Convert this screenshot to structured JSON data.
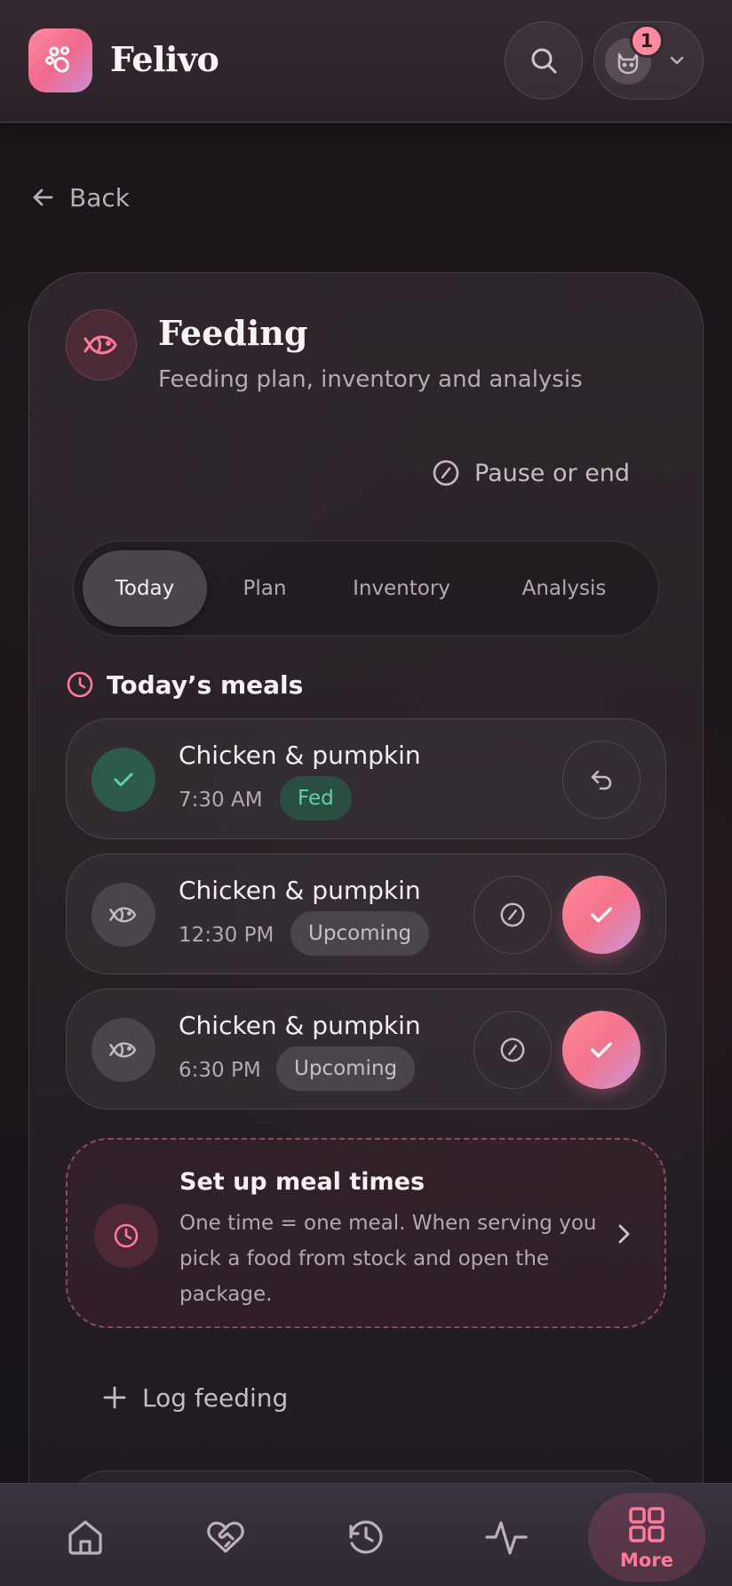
{
  "app": {
    "name": "Felivo",
    "notification_count": "1"
  },
  "icons": {
    "logo": "paw-icon",
    "search": "search-icon",
    "avatar": "cat-icon",
    "back": "arrow-left-icon",
    "feeding": "fish-icon",
    "pause": "slash-circle-icon",
    "clock": "clock-icon",
    "done": "check-icon",
    "undo": "undo-icon",
    "chevron": "chevron-right-icon",
    "plus": "plus-icon"
  },
  "nav": {
    "back_label": "Back"
  },
  "feeding": {
    "title": "Feeding",
    "subtitle": "Feeding plan, inventory and analysis",
    "pause_label": "Pause or end"
  },
  "tabs": [
    {
      "label": "Today",
      "active": true
    },
    {
      "label": "Plan",
      "active": false
    },
    {
      "label": "Inventory",
      "active": false
    },
    {
      "label": "Analysis",
      "active": false
    }
  ],
  "meals_section": {
    "title": "Today’s meals",
    "items": [
      {
        "name": "Chicken & pumpkin",
        "time": "7:30 AM",
        "status": "Fed"
      },
      {
        "name": "Chicken & pumpkin",
        "time": "12:30 PM",
        "status": "Upcoming"
      },
      {
        "name": "Chicken & pumpkin",
        "time": "6:30 PM",
        "status": "Upcoming"
      }
    ]
  },
  "setup": {
    "title": "Set up meal times",
    "body": "One time = one meal. When serving you pick a food from stock and open the package."
  },
  "log_feeding_label": "Log feeding",
  "bottom_nav": [
    {
      "icon": "home-icon",
      "label": "",
      "active": false
    },
    {
      "icon": "heart-handshake-icon",
      "label": "",
      "active": false
    },
    {
      "icon": "history-icon",
      "label": "",
      "active": false
    },
    {
      "icon": "activity-icon",
      "label": "",
      "active": false
    },
    {
      "icon": "grid-icon",
      "label": "More",
      "active": true
    }
  ],
  "colors": {
    "accent": "#ff7a9a",
    "success": "#5fd4a3",
    "background": "#17141b"
  }
}
